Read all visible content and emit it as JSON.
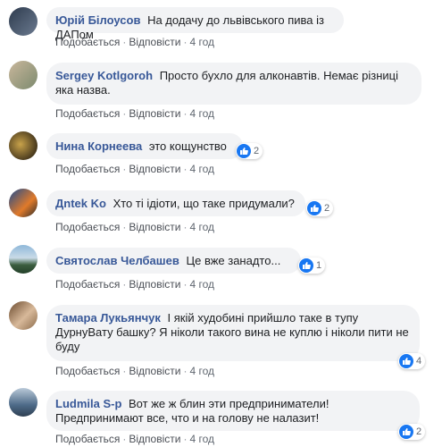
{
  "comments": [
    {
      "author": "Юрій Білоусов",
      "text": "На додачу до львівського пива із ДАПом",
      "likes": "",
      "time": "4 год"
    },
    {
      "author": "Sergey Kotlgoroh",
      "text": "Просто бухло для алконавтів. Немає різниці яка назва.",
      "likes": "",
      "time": "4 год"
    },
    {
      "author": "Нина Корнеева",
      "text": "это кощунство",
      "likes": "2",
      "time": "4 год"
    },
    {
      "author": "Дntek Ko",
      "text": "Хто ті ідіоти, що таке придумали?",
      "likes": "2",
      "time": "4 год"
    },
    {
      "author": "Святослав Челбашев",
      "text": "Це вже занадто...",
      "likes": "1",
      "time": "4 год"
    },
    {
      "author": "Тамара Лукьянчук",
      "text": "І якій худобині прийшло таке в тупу ДурнуВату башку? Я ніколи такого вина не куплю і ніколи пити не буду",
      "likes": "4",
      "time": "4 год"
    },
    {
      "author": "Ludmila S-p",
      "text": "Вот же ж блин эти предприниматели! Предпринимают все, что и на голову не налазит!",
      "likes": "2",
      "time": "4 год"
    }
  ],
  "actions": {
    "like": "Подобається",
    "reply": "Відповісти",
    "separator": "·"
  },
  "colors": {
    "author": "#385898",
    "bubble": "#f2f3f5",
    "like": "#1877f2"
  }
}
